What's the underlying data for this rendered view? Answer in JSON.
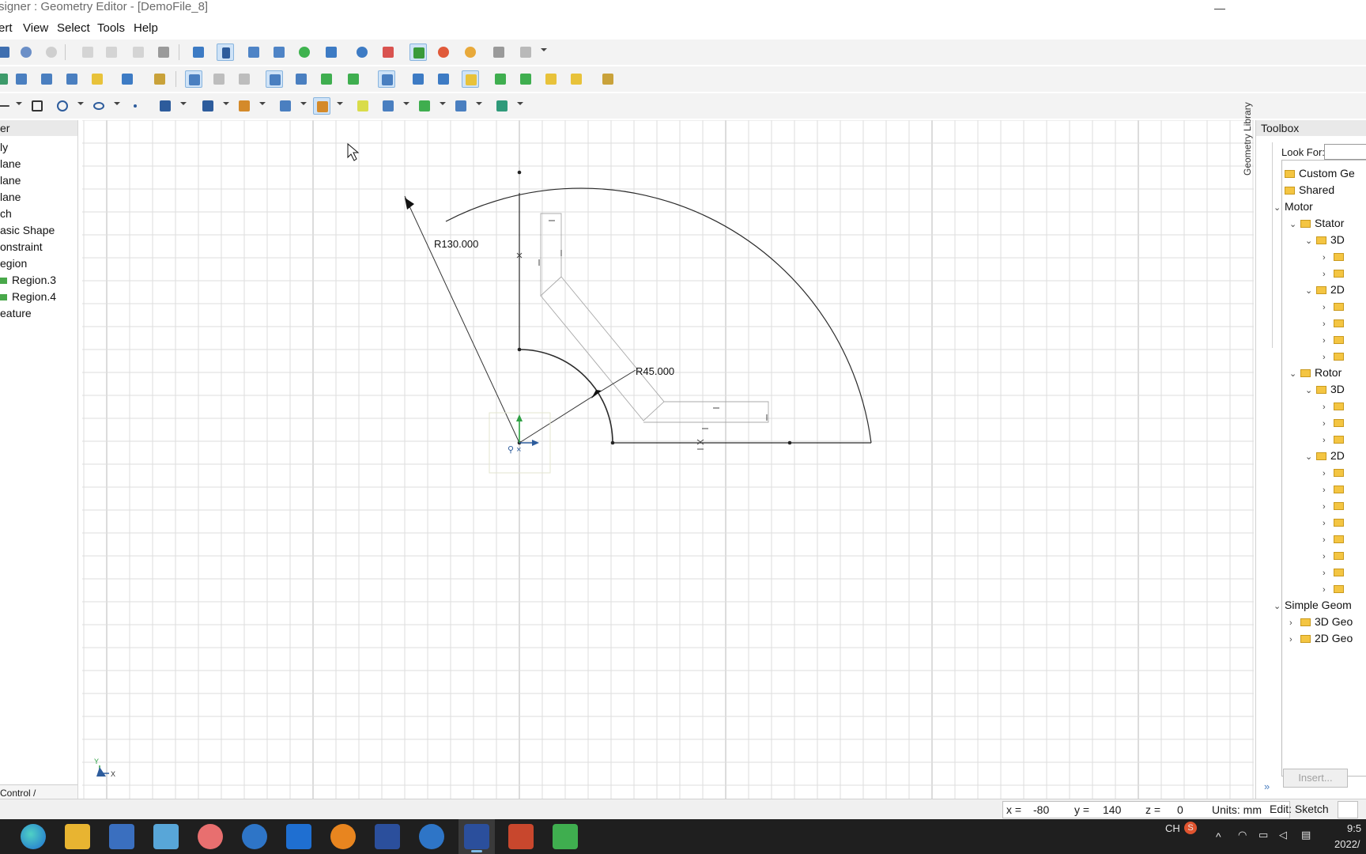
{
  "window": {
    "title": "signer : Geometry Editor - [DemoFile_8]",
    "minimize_glyph": "—"
  },
  "menu": [
    "ert",
    "View",
    "Select",
    "Tools",
    "Help"
  ],
  "left_panel": {
    "header": "er",
    "items": [
      "ly",
      "lane",
      "lane",
      "lane",
      "ch",
      "asic Shape",
      "onstraint",
      "egion",
      "Region.3",
      "Region.4",
      "eature"
    ],
    "tab": "Control /"
  },
  "canvas": {
    "dim_outer": "R130.000",
    "dim_inner": "R45.000",
    "axis_y": "Y",
    "axis_x": "X"
  },
  "toolbox": {
    "header": "Toolbox",
    "vertical_tab": "Geometry Library",
    "look_for_label": "Look For:",
    "items": [
      {
        "label": "Custom Ge",
        "indent": 0,
        "chevron": ""
      },
      {
        "label": "Shared",
        "indent": 0,
        "chevron": ""
      },
      {
        "label": "Motor",
        "indent": 0,
        "chevron": "v",
        "no_folder": true
      },
      {
        "label": "Stator",
        "indent": 1,
        "chevron": "v"
      },
      {
        "label": "3D",
        "indent": 2,
        "chevron": "v"
      },
      {
        "label": "",
        "indent": 3,
        "chevron": ">"
      },
      {
        "label": "",
        "indent": 3,
        "chevron": ">"
      },
      {
        "label": "2D",
        "indent": 2,
        "chevron": "v"
      },
      {
        "label": "",
        "indent": 3,
        "chevron": ">"
      },
      {
        "label": "",
        "indent": 3,
        "chevron": ">"
      },
      {
        "label": "",
        "indent": 3,
        "chevron": ">"
      },
      {
        "label": "",
        "indent": 3,
        "chevron": ">"
      },
      {
        "label": "Rotor",
        "indent": 1,
        "chevron": "v"
      },
      {
        "label": "3D",
        "indent": 2,
        "chevron": "v"
      },
      {
        "label": "",
        "indent": 3,
        "chevron": ">"
      },
      {
        "label": "",
        "indent": 3,
        "chevron": ">"
      },
      {
        "label": "",
        "indent": 3,
        "chevron": ">"
      },
      {
        "label": "2D",
        "indent": 2,
        "chevron": "v"
      },
      {
        "label": "",
        "indent": 3,
        "chevron": ">"
      },
      {
        "label": "",
        "indent": 3,
        "chevron": ">"
      },
      {
        "label": "",
        "indent": 3,
        "chevron": ">"
      },
      {
        "label": "",
        "indent": 3,
        "chevron": ">"
      },
      {
        "label": "",
        "indent": 3,
        "chevron": ">"
      },
      {
        "label": "",
        "indent": 3,
        "chevron": ">"
      },
      {
        "label": "",
        "indent": 3,
        "chevron": ">"
      },
      {
        "label": "",
        "indent": 3,
        "chevron": ">"
      },
      {
        "label": "Simple Geom",
        "indent": 0,
        "chevron": "v",
        "no_folder": true
      },
      {
        "label": "3D Geo",
        "indent": 1,
        "chevron": ">"
      },
      {
        "label": "2D Geo",
        "indent": 1,
        "chevron": ">"
      }
    ],
    "insert_label": "Insert..."
  },
  "status": {
    "x_label": "x =",
    "x_value": "-80",
    "y_label": "y =",
    "y_value": "140",
    "z_label": "z =",
    "z_value": "0",
    "units": "Units: mm",
    "edit_mode": "Edit: Sketch"
  },
  "taskbar": {
    "apps": [
      "edge",
      "file-explorer",
      "calculator",
      "notes",
      "paint",
      "app-n",
      "outlook",
      "search-app",
      "jmag-designer",
      "feedback",
      "jmag-active",
      "powerpoint",
      "photos"
    ],
    "lang": "CH",
    "ime": "S",
    "time": "9:5",
    "date": "2022/"
  },
  "colors": {
    "accent": "#4a90d9",
    "sketch_line": "#2b2b2b",
    "grid": "#d9d9d9",
    "region_green": "#49a84a",
    "taskbar": "#1f1f1f"
  }
}
